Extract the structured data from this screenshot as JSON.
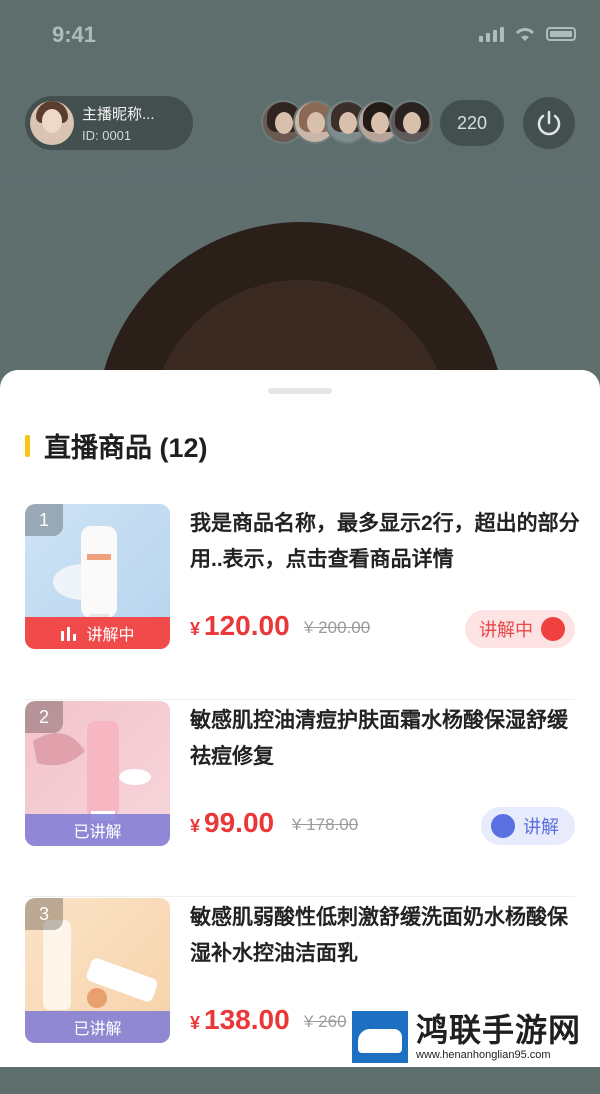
{
  "status_bar": {
    "time": "9:41"
  },
  "host": {
    "name": "主播昵称...",
    "id": "ID: 0001"
  },
  "viewer_count": "220",
  "sheet": {
    "title": "直播商品 (12)",
    "items": [
      {
        "index": "1",
        "name": "我是商品名称，最多显示2行，超出的部分用..表示，点击查看商品详情",
        "currency": "¥",
        "price": "120.00",
        "original_price": "¥ 200.00",
        "tag": "讲解中",
        "button": "讲解中",
        "state": "live"
      },
      {
        "index": "2",
        "name": "敏感肌控油清痘护肤面霜水杨酸保湿舒缓祛痘修复",
        "currency": "¥",
        "price": "99.00",
        "original_price": "¥ 178.00",
        "tag": "已讲解",
        "button": "讲解",
        "state": "idle"
      },
      {
        "index": "3",
        "name": "敏感肌弱酸性低刺激舒缓洗面奶水杨酸保湿补水控油洁面乳",
        "currency": "¥",
        "price": "138.00",
        "original_price": "¥ 260",
        "tag": "已讲解",
        "button": "",
        "state": "idle"
      }
    ]
  },
  "watermark": {
    "title": "鸿联手游网",
    "url": "www.henanhonglian95.com"
  },
  "colors": {
    "accent_red": "#ea3838",
    "title_bar": "#f5c518",
    "explain_blue": "#5a6fe0"
  }
}
